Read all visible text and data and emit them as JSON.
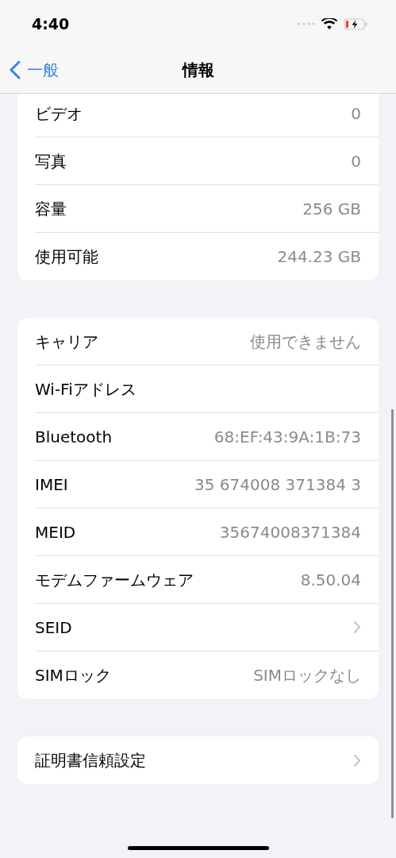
{
  "status_bar": {
    "time": "4:40"
  },
  "nav": {
    "back": "一般",
    "title": "情報"
  },
  "groups": [
    {
      "rows": [
        {
          "kind": "value",
          "label": "ビデオ",
          "value": "0"
        },
        {
          "kind": "value",
          "label": "写真",
          "value": "0"
        },
        {
          "kind": "value",
          "label": "容量",
          "value": "256 GB"
        },
        {
          "kind": "value",
          "label": "使用可能",
          "value": "244.23 GB"
        }
      ],
      "top_cut": true
    },
    {
      "rows": [
        {
          "kind": "value",
          "label": "キャリア",
          "value": "使用できません"
        },
        {
          "kind": "label",
          "label": "Wi-Fiアドレス"
        },
        {
          "kind": "value",
          "label": "Bluetooth",
          "value": "68:EF:43:9A:1B:73"
        },
        {
          "kind": "value",
          "label": "IMEI",
          "value": "35 674008 371384 3"
        },
        {
          "kind": "value",
          "label": "MEID",
          "value": "35674008371384"
        },
        {
          "kind": "value",
          "label": "モデムファームウェア",
          "value": "8.50.04"
        },
        {
          "kind": "link",
          "label": "SEID"
        },
        {
          "kind": "value",
          "label": "SIMロック",
          "value": "SIMロックなし"
        }
      ],
      "top_cut": false
    },
    {
      "rows": [
        {
          "kind": "link",
          "label": "証明書信頼設定"
        }
      ],
      "top_cut": false
    }
  ]
}
